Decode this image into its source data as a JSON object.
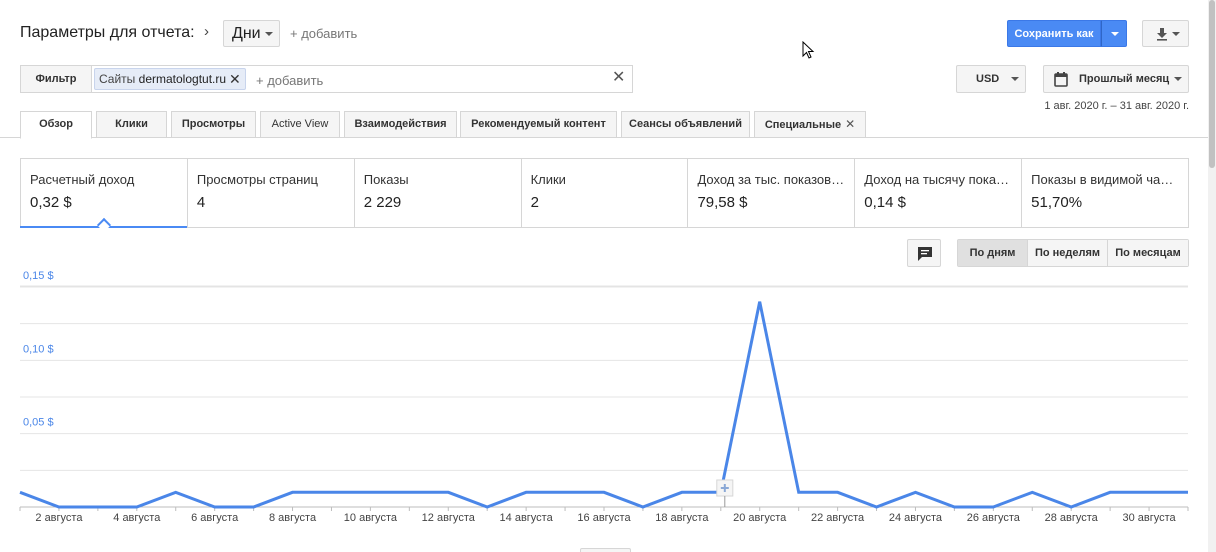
{
  "header": {
    "title": "Параметры для отчета:",
    "dimension": "Дни",
    "add_label": "+ добавить",
    "save_label": "Сохранить как"
  },
  "filter": {
    "label": "Фильтр",
    "chip_prefix": "Сайты",
    "chip_value": "dermatologtut.ru",
    "add_label": "+ добавить"
  },
  "controls": {
    "currency": "USD",
    "date_preset": "Прошлый месяц",
    "date_range": "1 авг. 2020 г. – 31 авг. 2020 г."
  },
  "tabs": [
    {
      "label": "Обзор"
    },
    {
      "label": "Клики"
    },
    {
      "label": "Просмотры"
    },
    {
      "label": "Active View"
    },
    {
      "label": "Взаимодействия"
    },
    {
      "label": "Рекомендуемый контент"
    },
    {
      "label": "Сеансы объявлений"
    },
    {
      "label": "Специальные"
    }
  ],
  "scorecards": [
    {
      "label": "Расчетный доход",
      "value": "0,32 $"
    },
    {
      "label": "Просмотры страниц",
      "value": "4"
    },
    {
      "label": "Показы",
      "value": "2 229"
    },
    {
      "label": "Клики",
      "value": "2"
    },
    {
      "label": "Доход за тыс. показов…",
      "value": "79,58 $"
    },
    {
      "label": "Доход на тысячу пока…",
      "value": "0,14 $"
    },
    {
      "label": "Показы в видимой ча…",
      "value": "51,70%"
    }
  ],
  "granularity": [
    {
      "label": "По дням"
    },
    {
      "label": "По неделям"
    },
    {
      "label": "По месяцам"
    }
  ],
  "colors": {
    "accent": "#4a8af4",
    "line": "#4a86e8"
  },
  "chart_data": {
    "type": "line",
    "series": [
      {
        "values": [
          0.01,
          0,
          0,
          0,
          0.01,
          0,
          0,
          0.01,
          0.01,
          0.01,
          0.01,
          0.01,
          0,
          0.01,
          0.01,
          0.01,
          0,
          0.01,
          0.01,
          0.14,
          0.01,
          0.01,
          0,
          0.01,
          0,
          0,
          0.01,
          0,
          0.01,
          0.01,
          0.01
        ]
      }
    ],
    "x": [
      "1 августа",
      "2 августа",
      "3 августа",
      "4 августа",
      "5 августа",
      "6 августа",
      "7 августа",
      "8 августа",
      "9 августа",
      "10 августа",
      "11 августа",
      "12 августа",
      "13 августа",
      "14 августа",
      "15 августа",
      "16 августа",
      "17 августа",
      "18 августа",
      "19 августа",
      "20 августа",
      "21 августа",
      "22 августа",
      "23 августа",
      "24 августа",
      "25 августа",
      "26 августа",
      "27 августа",
      "28 августа",
      "29 августа",
      "30 августа",
      "31 августа"
    ],
    "x_tick_labels": [
      "2 августа",
      "4 августа",
      "6 августа",
      "8 августа",
      "10 августа",
      "12 августа",
      "14 августа",
      "16 августа",
      "18 августа",
      "20 августа",
      "22 августа",
      "24 августа",
      "26 августа",
      "28 августа",
      "30 августа"
    ],
    "y_ticks": [
      {
        "value": 0.05,
        "label": "0,05 $"
      },
      {
        "value": 0.1,
        "label": "0,10 $"
      },
      {
        "value": 0.15,
        "label": "0,15 $"
      }
    ],
    "ylim": [
      0,
      0.15
    ],
    "grid": true
  }
}
